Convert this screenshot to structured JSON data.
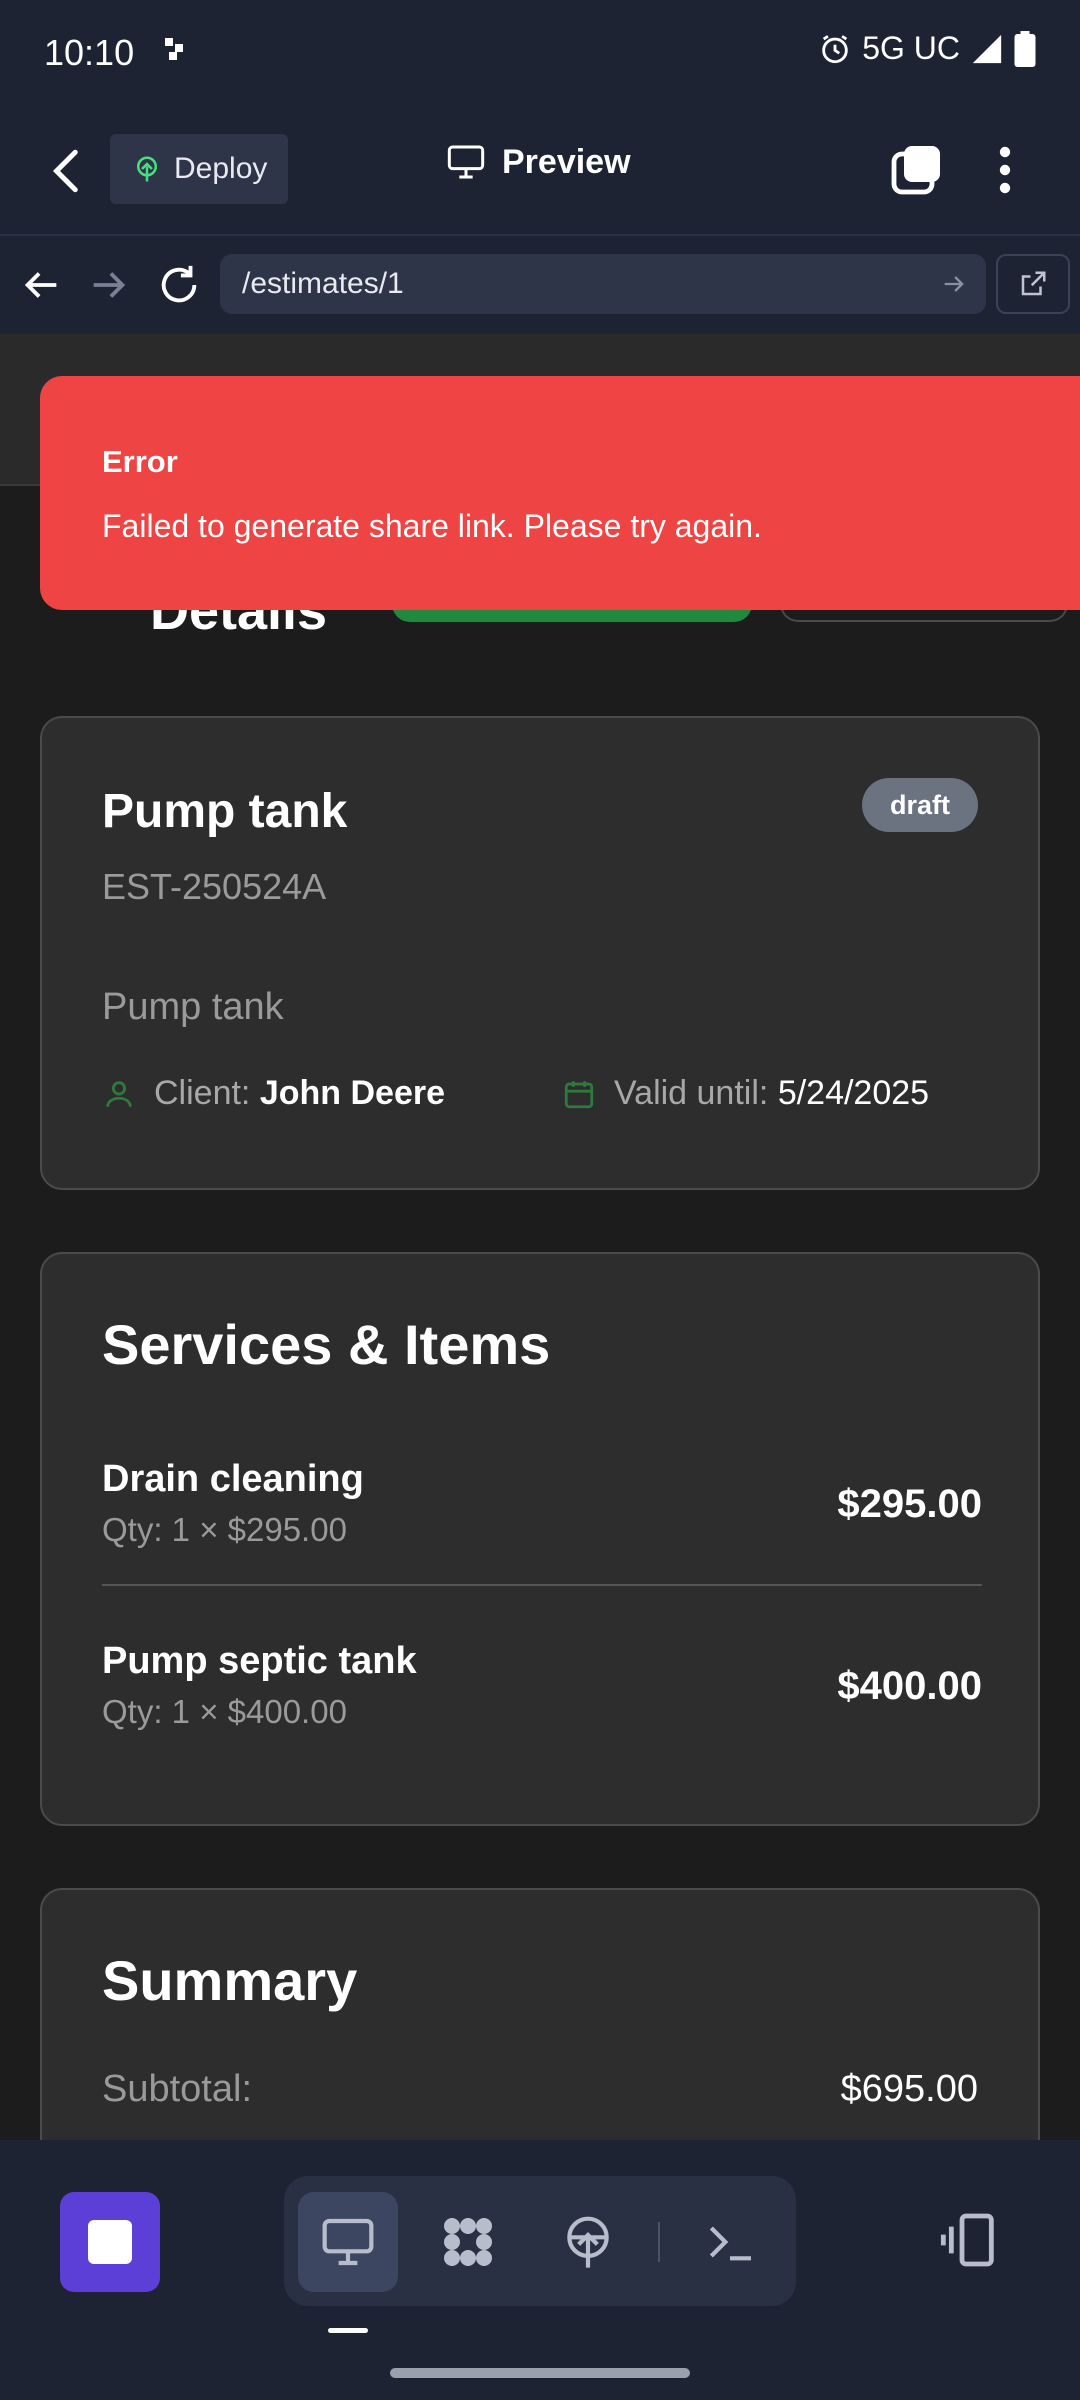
{
  "status_bar": {
    "time": "10:10",
    "network": "5G UC"
  },
  "header": {
    "deploy_label": "Deploy",
    "title": "Preview"
  },
  "browser": {
    "url": "/estimates/1"
  },
  "page": {
    "title_partial": "Details"
  },
  "toast": {
    "title": "Error",
    "message": "Failed to generate share link. Please try again.",
    "color": "#ef4444"
  },
  "estimate": {
    "title": "Pump tank",
    "status": "draft",
    "number": "EST-250524A",
    "description": "Pump tank",
    "client_label": "Client:",
    "client_name": "John Deere",
    "valid_label": "Valid until:",
    "valid_date": "5/24/2025"
  },
  "services": {
    "title": "Services & Items",
    "items": [
      {
        "name": "Drain cleaning",
        "qty": "Qty: 1 × $295.00",
        "amount": "$295.00"
      },
      {
        "name": "Pump septic tank",
        "qty": "Qty: 1 × $400.00",
        "amount": "$400.00"
      }
    ]
  },
  "summary": {
    "title": "Summary",
    "subtotal_label": "Subtotal:",
    "subtotal_value": "$695.00"
  },
  "bottom_bar": {
    "tools": [
      "desktop-icon",
      "apps-icon",
      "deploy-icon",
      "terminal-icon"
    ],
    "accent": "#5b3fd6"
  }
}
